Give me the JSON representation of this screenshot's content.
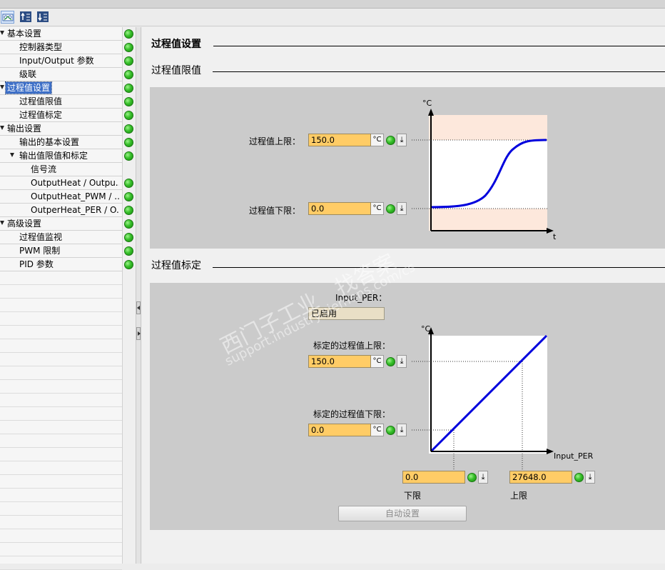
{
  "nav": {
    "items": [
      {
        "label": "基本设置",
        "level": 0,
        "expanded": true,
        "status": "ok",
        "selected": false
      },
      {
        "label": "控制器类型",
        "level": 1,
        "status": "ok",
        "selected": false
      },
      {
        "label": "Input/Output 参数",
        "level": 1,
        "status": "ok",
        "selected": false
      },
      {
        "label": "级联",
        "level": 1,
        "status": "ok",
        "selected": false
      },
      {
        "label": "过程值设置",
        "level": 0,
        "expanded": true,
        "status": "ok",
        "selected": true
      },
      {
        "label": "过程值限值",
        "level": 1,
        "status": "ok",
        "selected": false
      },
      {
        "label": "过程值标定",
        "level": 1,
        "status": "ok",
        "selected": false
      },
      {
        "label": "输出设置",
        "level": 0,
        "expanded": true,
        "status": "ok",
        "selected": false
      },
      {
        "label": "输出的基本设置",
        "level": 1,
        "status": "ok",
        "selected": false
      },
      {
        "label": "输出值限值和标定",
        "level": 1,
        "expanded": true,
        "status": "ok",
        "selected": false
      },
      {
        "label": "信号流",
        "level": 2,
        "status": "none",
        "selected": false
      },
      {
        "label": "OutputHeat / Outpu...",
        "level": 2,
        "status": "ok",
        "selected": false
      },
      {
        "label": "OutputHeat_PWM / ...",
        "level": 2,
        "status": "ok",
        "selected": false
      },
      {
        "label": "OutperHeat_PER / O...",
        "level": 2,
        "status": "ok",
        "selected": false
      },
      {
        "label": "高级设置",
        "level": 0,
        "expanded": true,
        "status": "ok",
        "selected": false
      },
      {
        "label": "过程值监视",
        "level": 1,
        "status": "ok",
        "selected": false
      },
      {
        "label": "PWM 限制",
        "level": 1,
        "status": "ok",
        "selected": false
      },
      {
        "label": "PID 参数",
        "level": 1,
        "status": "ok",
        "selected": false
      }
    ]
  },
  "main": {
    "title": "过程值设置",
    "limits": {
      "section_label": "过程值限值",
      "high_label": "过程值上限：",
      "high_value": "150.0",
      "low_label": "过程值下限：",
      "low_value": "0.0",
      "unit": "°C",
      "chart_y_label": "°C",
      "chart_x_label": "t"
    },
    "scaling": {
      "section_label": "过程值标定",
      "input_per_label": "Input_PER：",
      "input_per_value": "已启用",
      "scaled_high_label": "标定的过程值上限：",
      "scaled_high_value": "150.0",
      "scaled_low_label": "标定的过程值下限：",
      "scaled_low_value": "0.0",
      "unit": "°C",
      "chart_y_label": "°C",
      "chart_x_label": "Input_PER",
      "lower_value": "0.0",
      "upper_value": "27648.0",
      "lower_label": "下限",
      "upper_label": "上限",
      "auto_button": "自动设置"
    }
  },
  "watermark": {
    "line1": "西门子工业　找答案",
    "line2": "support.industry.siemens.com/cs"
  },
  "colors": {
    "field_bg": "#ffcc66",
    "status_ok": "#2fb52a",
    "chart_curve": "#0000dd",
    "limit_zone": "#fde8dc",
    "selection": "#3d6fc7"
  }
}
